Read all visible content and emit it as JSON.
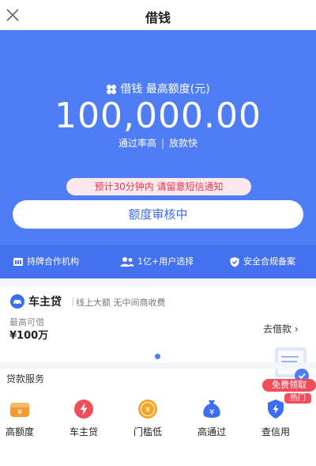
{
  "nav": {
    "title": "借钱"
  },
  "hero": {
    "quota_label": "借钱 最高额度(元)",
    "amount": "100,000.00",
    "tag_1": "通过率高",
    "tag_sep": "|",
    "tag_2": "放款快",
    "notice": "预计30分钟内 请留意短信通知",
    "button": "额度审核中"
  },
  "features": [
    {
      "label": "持牌合作机构",
      "icon": "bank-icon"
    },
    {
      "label": "1亿+用户选择",
      "icon": "users-icon"
    },
    {
      "label": "安全合规备案",
      "icon": "shield-check-icon"
    }
  ],
  "product": {
    "name": "车主贷",
    "desc": "线上大额 无中间商收费",
    "max_label": "最高可借",
    "max_value": "¥100万",
    "link": "去借款 ›"
  },
  "promo": {
    "button": "免费领取",
    "badge": "热门"
  },
  "services": {
    "title": "贷款服务",
    "items": [
      {
        "label": "高额度",
        "icon": "yen-wallet-icon",
        "color": "#f59a32"
      },
      {
        "label": "车主贷",
        "icon": "lightning-icon",
        "color": "#f24d5b"
      },
      {
        "label": "门槛低",
        "icon": "yen-coin-icon",
        "color": "#f5a524"
      },
      {
        "label": "高通过",
        "icon": "money-bag-icon",
        "color": "#3c6ef0"
      },
      {
        "label": "查信用",
        "icon": "shield-lightning-icon",
        "color": "#3c6ef0"
      }
    ]
  }
}
